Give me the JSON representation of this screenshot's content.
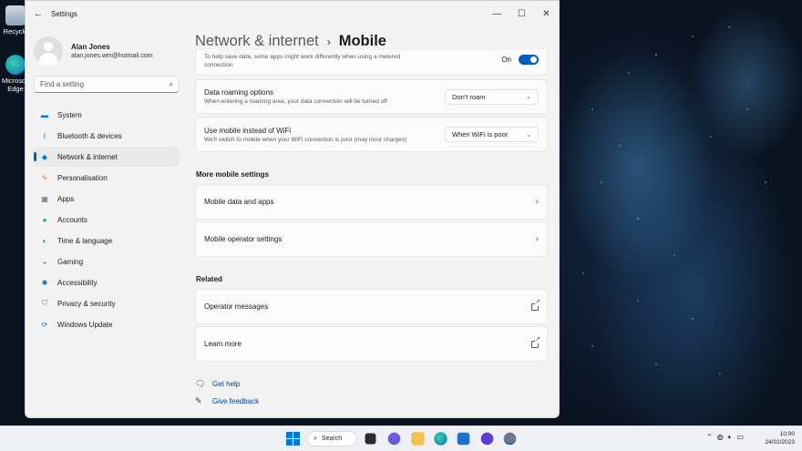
{
  "window": {
    "title": "Settings"
  },
  "profile": {
    "name": "Alan Jones",
    "email": "alan.jones.wm@hotmail.com"
  },
  "search": {
    "placeholder": "Find a setting"
  },
  "nav": [
    {
      "label": "System",
      "icon": "monitor-icon",
      "color": "#0078d4"
    },
    {
      "label": "Bluetooth & devices",
      "icon": "bluetooth-icon",
      "color": "#0078d4"
    },
    {
      "label": "Network & internet",
      "icon": "wifi-icon",
      "color": "#0078d4",
      "active": true
    },
    {
      "label": "Personalisation",
      "icon": "brush-icon",
      "color": "#d48a3a"
    },
    {
      "label": "Apps",
      "icon": "apps-icon",
      "color": "#5a6b7d"
    },
    {
      "label": "Accounts",
      "icon": "person-icon",
      "color": "#1aa37a"
    },
    {
      "label": "Time & language",
      "icon": "globe-clock-icon",
      "color": "#0078d4"
    },
    {
      "label": "Gaming",
      "icon": "gamepad-icon",
      "color": "#7a7a7a"
    },
    {
      "label": "Accessibility",
      "icon": "accessibility-icon",
      "color": "#0067c0"
    },
    {
      "label": "Privacy & security",
      "icon": "shield-icon",
      "color": "#6b6b6b"
    },
    {
      "label": "Windows Update",
      "icon": "update-icon",
      "color": "#0078d4"
    }
  ],
  "breadcrumb": {
    "parent": "Network & internet",
    "separator": "›",
    "current": "Mobile"
  },
  "cards": {
    "metered": {
      "subtitle_line1": "To help save data, some apps might work differently when using a metered",
      "subtitle_line2": "connection",
      "state": "On"
    },
    "roaming": {
      "title": "Data roaming options",
      "subtitle": "When entering a roaming area, your data connection will be turned off",
      "value": "Don't roam"
    },
    "mobile_instead": {
      "title": "Use mobile instead of WiFi",
      "subtitle": "We'll switch to mobile when your WiFi connection is poor (may incur charges)",
      "value": "When WiFi is poor"
    }
  },
  "more_section": {
    "heading": "More mobile settings",
    "items": [
      "Mobile data and apps",
      "Mobile operator settings"
    ]
  },
  "related_section": {
    "heading": "Related",
    "items": [
      "Operator messages",
      "Learn more"
    ]
  },
  "help": {
    "get_help": "Get help",
    "give_feedback": "Give feedback"
  },
  "desktop": {
    "icons": [
      "Recycle",
      "Microsoft Edge"
    ]
  },
  "taskbar": {
    "search_label": "Search",
    "time": "10:00",
    "date": "24/02/2023"
  },
  "colors": {
    "accent": "#005fb8",
    "link": "#003e92"
  }
}
